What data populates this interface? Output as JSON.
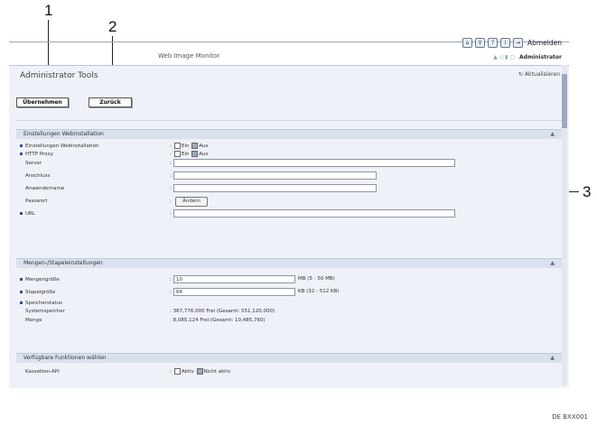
{
  "callouts": {
    "c1": "1",
    "c2": "2",
    "c3": "3"
  },
  "header": {
    "app_title": "Web Image Monitor",
    "logout_label": "Abmelden",
    "user_label": "Administrator",
    "icons": [
      "home-icon",
      "search-icon",
      "help-icon",
      "info-icon",
      "logout-icon"
    ]
  },
  "page": {
    "title": "Administrator Tools",
    "refresh_label": "Aktualisieren"
  },
  "toolbar": {
    "apply_label": "Übernehmen",
    "back_label": "Zurück"
  },
  "webinstall": {
    "heading": "Einstellungen Webinstallation",
    "rows": [
      {
        "label": "Einstellungen Webinstallation",
        "opt_on": "Ein",
        "opt_off": "Aus",
        "checked": "Aus"
      },
      {
        "label": "HTTP Proxy",
        "opt_on": "Ein",
        "opt_off": "Aus",
        "checked": "Aus"
      },
      {
        "label": "Server",
        "value": ""
      },
      {
        "label": "Anschluss",
        "value": ""
      },
      {
        "label": "Anwendername",
        "value": ""
      },
      {
        "label": "Passwort",
        "button": "Ändern"
      },
      {
        "label": "URL",
        "value": ""
      }
    ]
  },
  "storage": {
    "heading": "Mengen-/Stapeleinstellungen",
    "rows": [
      {
        "label": "Mengengröße",
        "value": "10",
        "unit": "MB (5 - 50 MB)"
      },
      {
        "label": "Stapelgröße",
        "value": "64",
        "unit": "KB (32 - 512 KB)"
      },
      {
        "label": "Speicherstatus"
      },
      {
        "label": "Systemspeicher",
        "value": ": 367,776,000  Frei    (Gesamt: 551,120,000)"
      },
      {
        "label": "Menge",
        "value": ":   8,085,124  Frei    (Gesamt: 10,485,760)"
      }
    ]
  },
  "functions": {
    "heading": "Verfügbare Funktionen wählen",
    "rows": [
      {
        "label": "Kassetten-API",
        "opt_on": "Aktiv",
        "opt_off": "Nicht aktiv",
        "checked": "Nicht aktiv"
      }
    ]
  },
  "footer_code": "DE BXX001"
}
